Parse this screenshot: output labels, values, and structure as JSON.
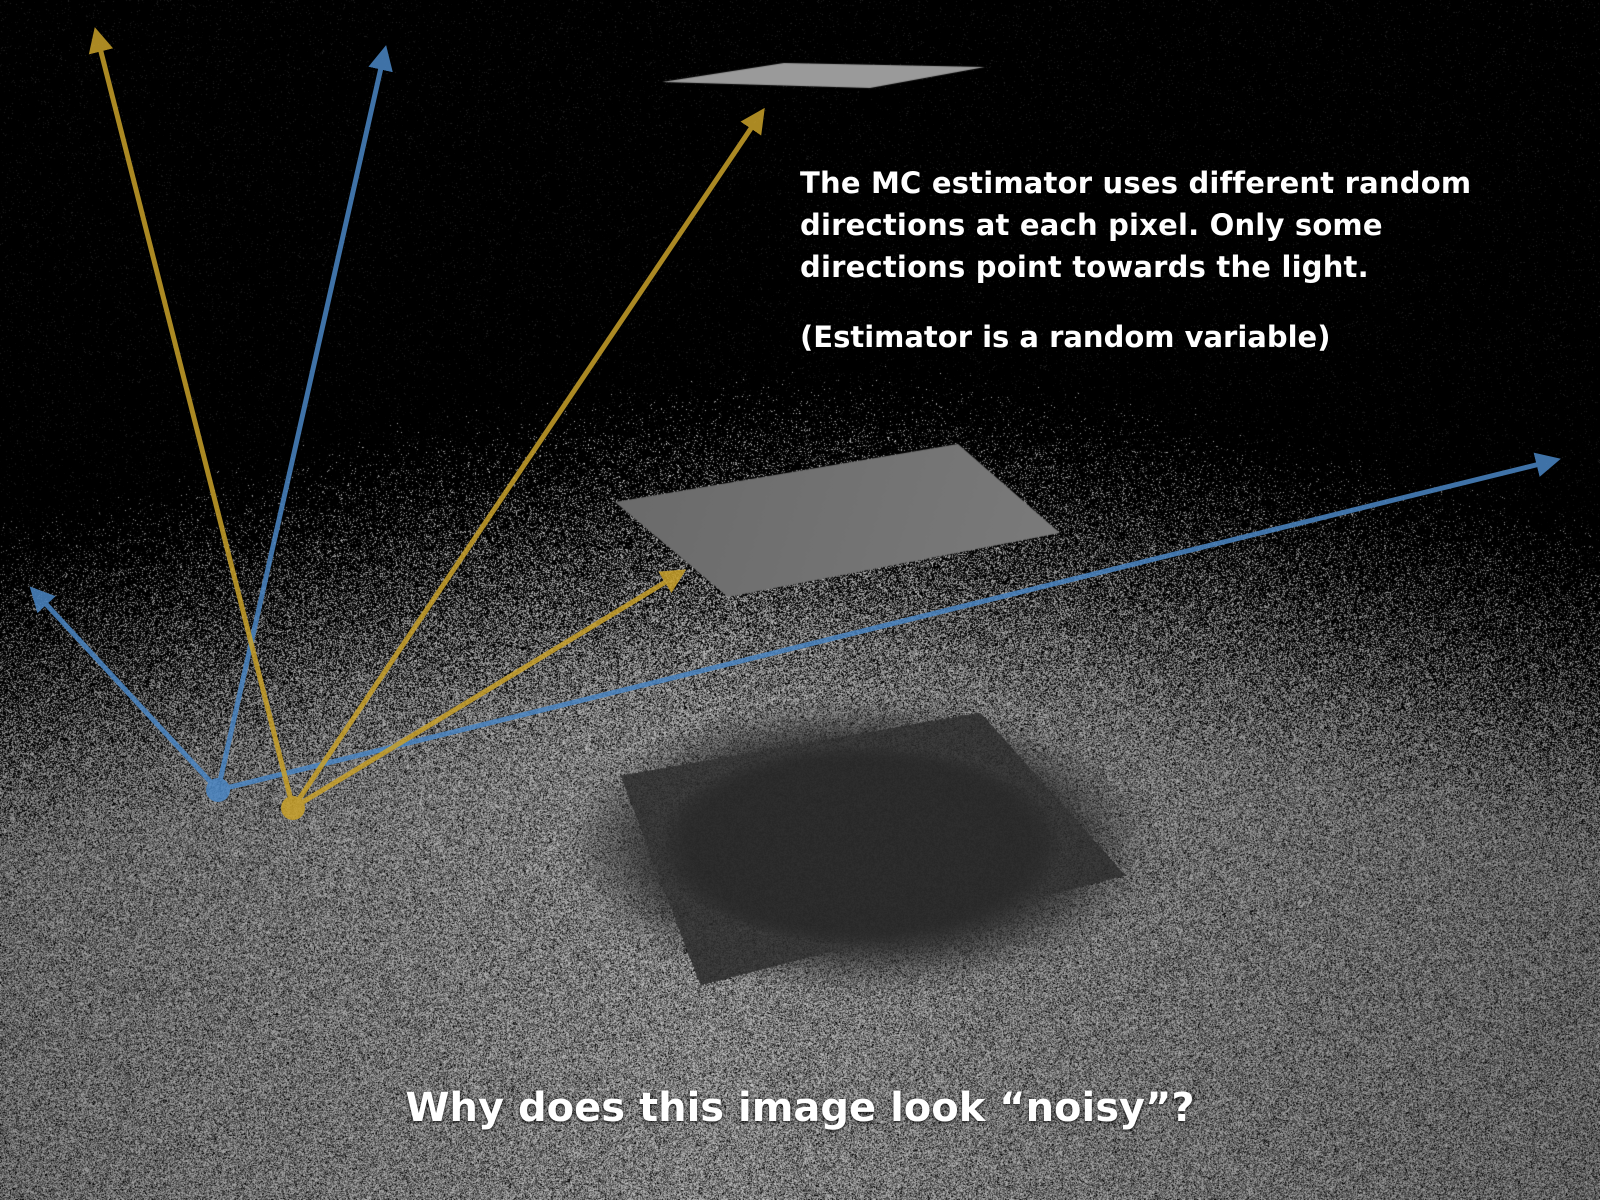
{
  "text": {
    "explanation": "The MC estimator uses different random directions at each pixel. Only some directions point towards the light.",
    "note": "(Estimator is a random variable)",
    "question": "Why does this image look “noisy”?"
  },
  "colors": {
    "blue_rays": "#4a86c5",
    "yellow_rays": "#c9a12a",
    "background": "#000000",
    "light_panel": "#9a9a9a",
    "occluder": "#6f6f6f"
  },
  "ray_groups": [
    {
      "name": "blue",
      "color": "#4a86c5",
      "origin_marker": "dot"
    },
    {
      "name": "yellow",
      "color": "#c9a12a",
      "origin_marker": "dot"
    }
  ]
}
